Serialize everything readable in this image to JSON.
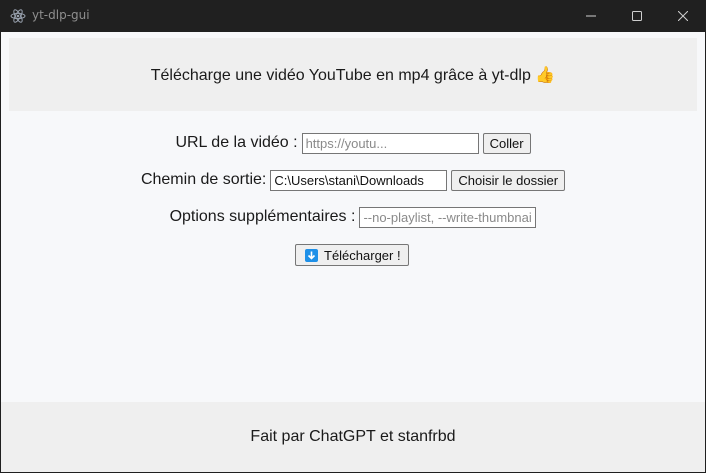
{
  "window": {
    "title": "yt-dlp-gui",
    "icon": "electron-atom-icon",
    "controls": [
      "minimize-icon",
      "maximize-icon",
      "close-icon"
    ]
  },
  "header": {
    "text": "Télécharge une vidéo YouTube en mp4 grâce à yt-dlp 👍"
  },
  "form": {
    "url": {
      "label": "URL de la vidéo :",
      "placeholder": "https://youtu...",
      "value": "",
      "button": "Coller"
    },
    "output": {
      "label": "Chemin de sortie:",
      "value": "C:\\Users\\stani\\Downloads",
      "button": "Choisir le dossier"
    },
    "options": {
      "label": "Options supplémentaires :",
      "placeholder": "--no-playlist, --write-thumbnail",
      "value": ""
    },
    "download_button": {
      "icon": "download-arrow-icon",
      "label": "Télécharger !"
    }
  },
  "footer": {
    "text": "Fait par ChatGPT et stanfrbd"
  },
  "colors": {
    "titlebar": "#202020",
    "content_bg": "#f7f8fa",
    "panel_bg": "#efefef",
    "download_icon": "#1e90e8"
  }
}
